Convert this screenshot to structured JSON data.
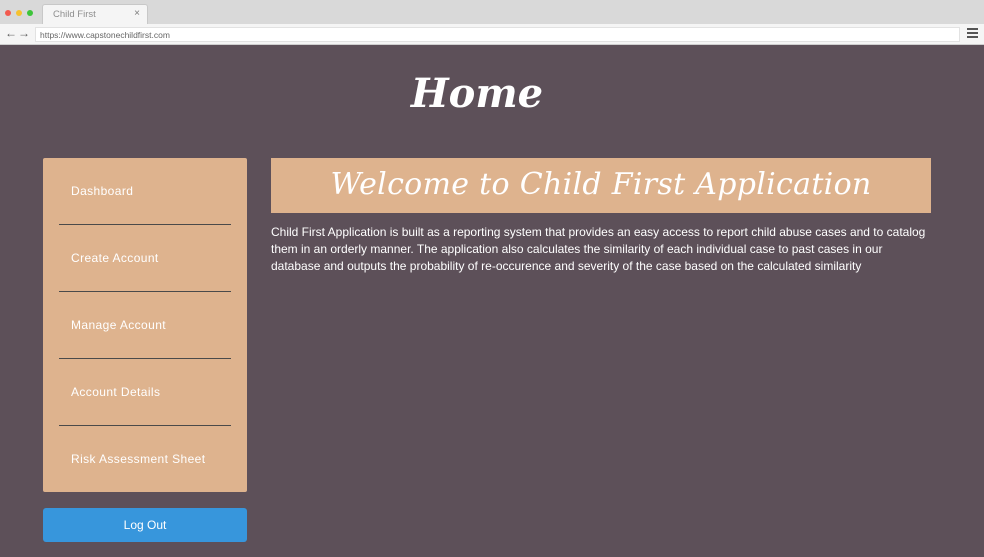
{
  "browser": {
    "tab_title": "Child First",
    "tab_close": "×",
    "url": "https://www.capstonechildfirst.com",
    "back_glyph": "←",
    "forward_glyph": "→"
  },
  "page": {
    "title": "Home",
    "welcome_heading": "Welcome to Child First Application",
    "description": "Child First Application is built as a reporting system that provides an easy access to report child abuse cases and to catalog them in an orderly manner. The application also calculates the similarity of each individual case to past cases in our database and outputs the probability of re-occurence and severity of the case based on the calculated similarity"
  },
  "sidebar": {
    "items": [
      {
        "label": "Dashboard"
      },
      {
        "label": "Create Account"
      },
      {
        "label": "Manage Account"
      },
      {
        "label": "Account Details"
      },
      {
        "label": "Risk Assessment Sheet"
      }
    ],
    "logout_label": "Log Out"
  },
  "colors": {
    "background": "#5d5059",
    "accent": "#deb38e",
    "button": "#3796dc",
    "text": "#ffffff"
  }
}
